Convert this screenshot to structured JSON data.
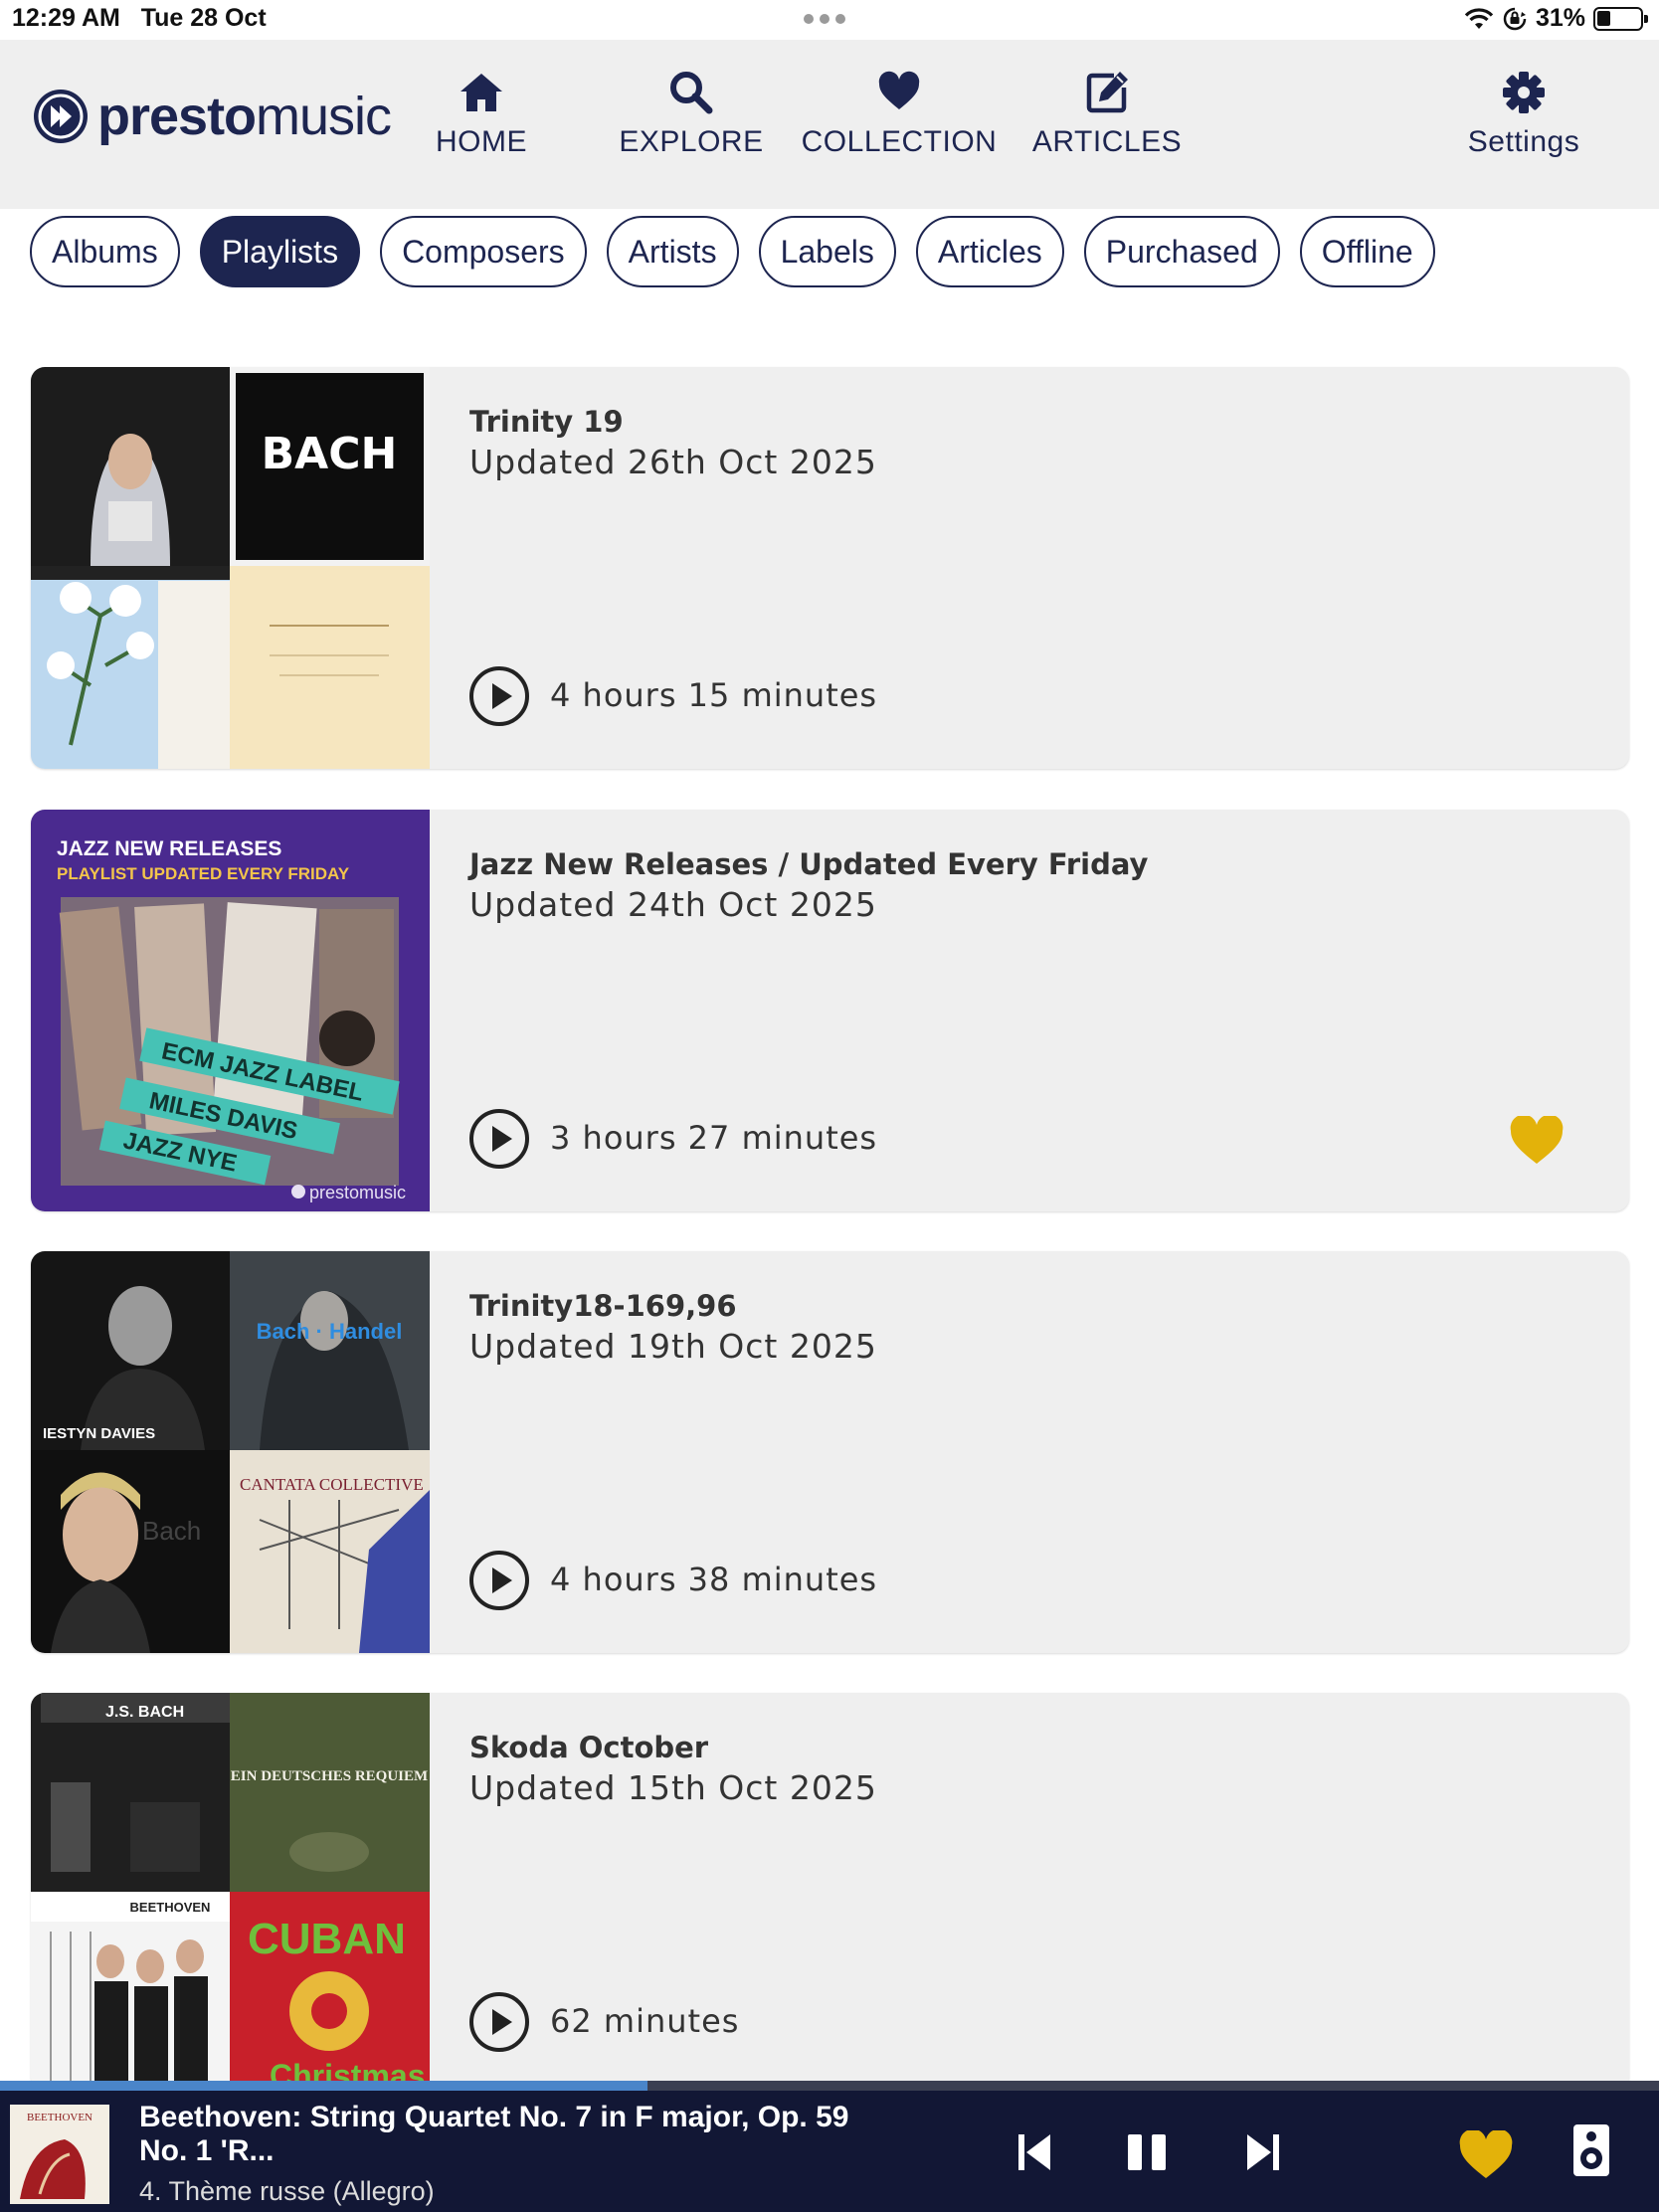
{
  "status_bar": {
    "time": "12:29 AM",
    "date": "Tue 28 Oct",
    "battery_percent": "31%",
    "battery_level": 0.31
  },
  "header": {
    "logo_bold": "presto",
    "logo_light": "music",
    "nav": [
      {
        "label": "HOME",
        "icon": "home-icon"
      },
      {
        "label": "EXPLORE",
        "icon": "search-icon"
      },
      {
        "label": "COLLECTION",
        "icon": "heart-icon"
      },
      {
        "label": "ARTICLES",
        "icon": "edit-icon"
      }
    ],
    "settings": {
      "label": "Settings",
      "icon": "gear-icon"
    }
  },
  "filters": [
    {
      "label": "Albums",
      "active": false
    },
    {
      "label": "Playlists",
      "active": true
    },
    {
      "label": "Composers",
      "active": false
    },
    {
      "label": "Artists",
      "active": false
    },
    {
      "label": "Labels",
      "active": false
    },
    {
      "label": "Articles",
      "active": false
    },
    {
      "label": "Purchased",
      "active": false
    },
    {
      "label": "Offline",
      "active": false
    }
  ],
  "playlists": [
    {
      "title": "Trinity 19",
      "updated": "Updated 26th Oct 2025",
      "duration": "4 hours 15 minutes",
      "favourite": false,
      "art": {
        "bach_text": "BACH"
      }
    },
    {
      "title": "Jazz New Releases / Updated Every Friday",
      "updated": "Updated 24th Oct 2025",
      "duration": "3 hours 27 minutes",
      "favourite": true,
      "art": {
        "line1": "JAZZ NEW RELEASES",
        "line2": "PLAYLIST UPDATED EVERY FRIDAY",
        "tag1": "ECM JAZZ LABEL",
        "tag2": "MILES DAVIS",
        "tag3": "JAZZ NYE",
        "brand": "prestomusic"
      }
    },
    {
      "title": "Trinity18-169,96",
      "updated": "Updated 19th Oct 2025",
      "duration": "4 hours 38 minutes",
      "favourite": false,
      "art": {
        "name": "IESTYN DAVIES",
        "bach_handel": "Bach · Handel",
        "cantata": "CANTATA COLLECTIVE",
        "bach_small": "Bach"
      }
    },
    {
      "title": "Skoda October",
      "updated": "Updated 15th Oct 2025",
      "duration": "62 minutes",
      "favourite": false,
      "art": {
        "js_bach": "J.S. BACH",
        "brahms": "EIN DEUTSCHES REQUIEM",
        "beethoven": "BEETHOVEN",
        "cuban": "CUBAN",
        "christmas": "Christmas"
      }
    }
  ],
  "player": {
    "title": "Beethoven: String Quartet No. 7 in F major, Op. 59 No. 1 'R...",
    "subtitle": "4. Thème russe (Allegro)",
    "progress": 0.39,
    "art_text": "BEETHOVEN",
    "favourite_color": "#e3b20a"
  },
  "colors": {
    "navy": "#1d2550",
    "gold": "#e3b20a",
    "card_bg": "#efefef",
    "player_bg": "#121735",
    "progress": "#4a85c9"
  }
}
